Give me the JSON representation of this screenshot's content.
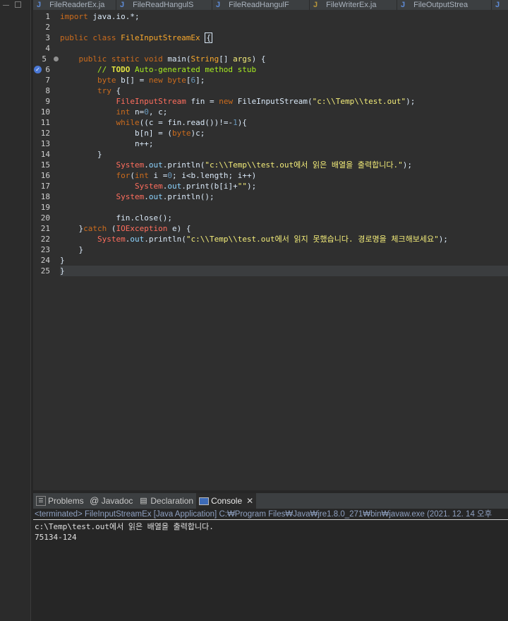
{
  "editor_tabs": [
    {
      "label": "FileReaderEx.ja",
      "icon": "java-file-icon"
    },
    {
      "label": "FileReadHangulS",
      "icon": "java-file-icon"
    },
    {
      "label": "FileReadHangulF",
      "icon": "java-file-icon"
    },
    {
      "label": "FileWriterEx.ja",
      "icon": "java-file-icon"
    },
    {
      "label": "FileOutputStrea",
      "icon": "java-file-icon"
    }
  ],
  "code": {
    "line_numbers": [
      "1",
      "2",
      "3",
      "4",
      "5",
      "6",
      "7",
      "8",
      "9",
      "10",
      "11",
      "12",
      "13",
      "14",
      "15",
      "16",
      "17",
      "18",
      "19",
      "20",
      "21",
      "22",
      "23",
      "24",
      "25"
    ],
    "lines": [
      "import java.io.*;",
      "",
      "public class FileInputStreamEx {",
      "",
      "    public static void main(String[] args) {",
      "        // TODO Auto-generated method stub",
      "        byte b[] = new byte[6];",
      "        try {",
      "            FileInputStream fin = new FileInputStream(\"c:\\\\Temp\\\\test.out\");",
      "            int n=0, c;",
      "            while((c = fin.read())!=-1){",
      "                b[n] = (byte)c;",
      "                n++;",
      "        }",
      "            System.out.println(\"c:\\\\Temp\\\\test.out에서 읽은 배열을 출력합니다.\");",
      "            for(int i =0; i<b.length; i++)",
      "                System.out.print(b[i]+\"\");",
      "            System.out.println();",
      "",
      "            fin.close();",
      "    }catch (IOException e) {",
      "        System.out.println(\"c:\\\\Temp\\\\test.out에서 읽지 못했습니다. 경로명을 체크해보세요\");",
      "    }",
      "}",
      "}"
    ]
  },
  "bottom_panel": {
    "tabs": [
      {
        "label": "Problems",
        "icon": "problems-icon"
      },
      {
        "label": "Javadoc",
        "icon": "at-icon"
      },
      {
        "label": "Declaration",
        "icon": "declaration-icon"
      },
      {
        "label": "Console",
        "icon": "console-icon",
        "active": true
      }
    ],
    "terminated_text": "<terminated> FileInputStreamEx [Java Application] C:₩Program Files₩Java₩jre1.8.0_271₩bin₩javaw.exe  (2021. 12. 14 오후",
    "console_output": [
      "c:\\Temp\\test.out에서 읽은 배열을 출력합니다.",
      "75134-124"
    ]
  }
}
